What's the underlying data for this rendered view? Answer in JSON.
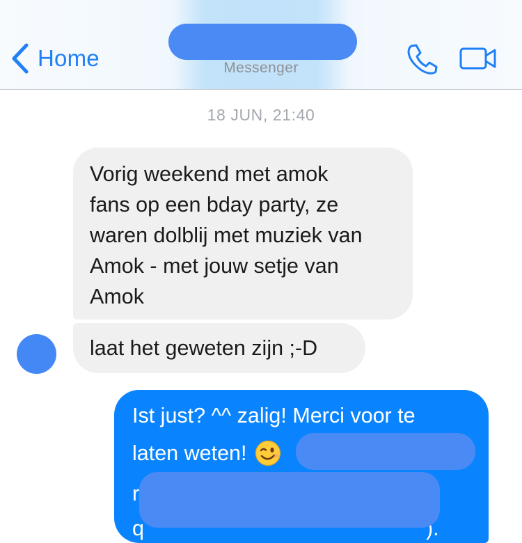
{
  "header": {
    "back_label": "Home",
    "subtitle": "Messenger",
    "icons": {
      "back": "chevron-left-icon",
      "call": "phone-icon",
      "video": "video-camera-icon"
    },
    "accent_color": "#1f80f5"
  },
  "conversation": {
    "timestamp": "18 JUN, 21:40",
    "incoming": [
      {
        "lines": [
          "Vorig weekend met amok",
          "fans op een bday party, ze",
          "waren dolblij met muziek van",
          "Amok - met jouw setje van",
          "Amok"
        ]
      },
      {
        "lines": [
          "laat het geweten zijn ;-D"
        ]
      }
    ],
    "outgoing": {
      "line1": "Ist just? ^^ zalig! Merci voor te",
      "line2": "laten weten!",
      "emoji": "winking-face-icon",
      "partial_left_1": "r",
      "partial_left_2": "q",
      "partial_right": ")."
    },
    "colors": {
      "incoming_bubble": "#f1f0f0",
      "outgoing_bubble": "#0984fe",
      "redaction": "#4a8af5"
    }
  }
}
